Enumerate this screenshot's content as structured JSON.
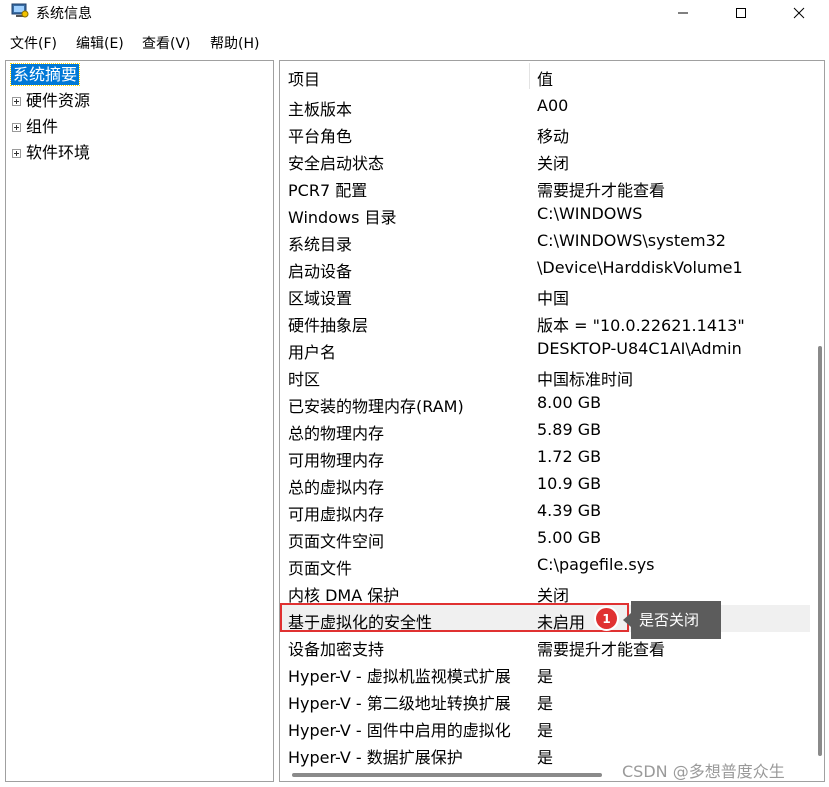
{
  "window": {
    "title": "系统信息"
  },
  "menu": [
    "文件(F)",
    "编辑(E)",
    "查看(V)",
    "帮助(H)"
  ],
  "tree": {
    "root": "系统摘要",
    "children": [
      "硬件资源",
      "组件",
      "软件环境"
    ]
  },
  "table": {
    "headers": [
      "项目",
      "值"
    ],
    "rows": [
      {
        "k": "主板版本",
        "v": "A00"
      },
      {
        "k": "平台角色",
        "v": "移动"
      },
      {
        "k": "安全启动状态",
        "v": "关闭"
      },
      {
        "k": "PCR7 配置",
        "v": "需要提升才能查看"
      },
      {
        "k": "Windows 目录",
        "v": "C:\\WINDOWS"
      },
      {
        "k": "系统目录",
        "v": "C:\\WINDOWS\\system32"
      },
      {
        "k": "启动设备",
        "v": "\\Device\\HarddiskVolume1"
      },
      {
        "k": "区域设置",
        "v": "中国"
      },
      {
        "k": "硬件抽象层",
        "v": "版本 = \"10.0.22621.1413\""
      },
      {
        "k": "用户名",
        "v": "DESKTOP-U84C1AI\\Admin"
      },
      {
        "k": "时区",
        "v": "中国标准时间"
      },
      {
        "k": "已安装的物理内存(RAM)",
        "v": "8.00 GB"
      },
      {
        "k": "总的物理内存",
        "v": "5.89 GB"
      },
      {
        "k": "可用物理内存",
        "v": "1.72 GB"
      },
      {
        "k": "总的虚拟内存",
        "v": "10.9 GB"
      },
      {
        "k": "可用虚拟内存",
        "v": "4.39 GB"
      },
      {
        "k": "页面文件空间",
        "v": "5.00 GB"
      },
      {
        "k": "页面文件",
        "v": "C:\\pagefile.sys"
      },
      {
        "k": "内核 DMA 保护",
        "v": "关闭"
      },
      {
        "k": "基于虚拟化的安全性",
        "v": "未启用"
      },
      {
        "k": "设备加密支持",
        "v": "需要提升才能查看"
      },
      {
        "k": "Hyper-V - 虚拟机监视模式扩展",
        "v": "是"
      },
      {
        "k": "Hyper-V - 第二级地址转换扩展",
        "v": "是"
      },
      {
        "k": "Hyper-V - 固件中启用的虚拟化",
        "v": "是"
      },
      {
        "k": "Hyper-V - 数据扩展保护",
        "v": "是"
      }
    ]
  },
  "annotation": {
    "badge": "1",
    "tooltip": "是否关闭"
  },
  "watermark": "CSDN @多想普度众生",
  "colors": {
    "selection": "#0078d7",
    "annotation": "#e03131",
    "tooltip_bg": "#5c5c5c"
  }
}
